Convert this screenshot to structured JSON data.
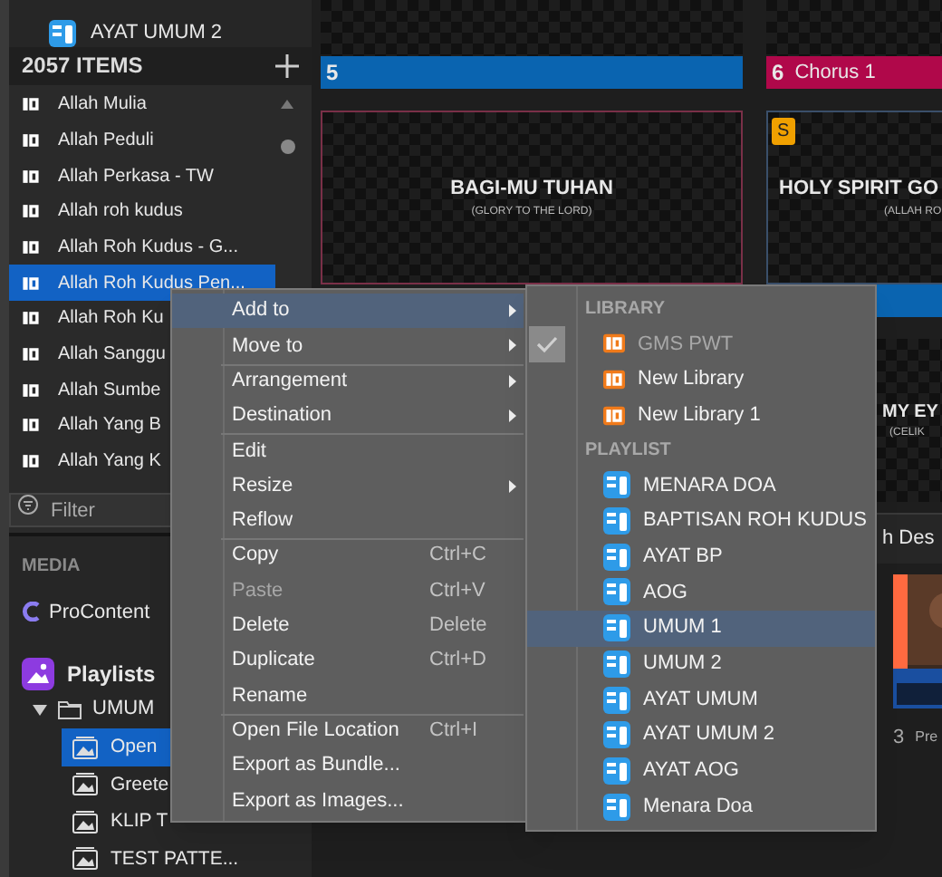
{
  "playlist_rows": [
    {
      "label": "AYAT UMUM 2"
    }
  ],
  "library": {
    "count": "2057 ITEMS",
    "items": [
      {
        "label": "Allah Mulia",
        "selected": false
      },
      {
        "label": "Allah Peduli",
        "selected": false
      },
      {
        "label": "Allah Perkasa - TW",
        "selected": false
      },
      {
        "label": "Allah roh kudus",
        "selected": false
      },
      {
        "label": "Allah Roh Kudus - G...",
        "selected": false
      },
      {
        "label": "Allah Roh Kudus Pen...",
        "selected": true
      },
      {
        "label": "Allah Roh Ku",
        "selected": false
      },
      {
        "label": "Allah Sanggu",
        "selected": false
      },
      {
        "label": "Allah Sumbe",
        "selected": false
      },
      {
        "label": "Allah Yang B",
        "selected": false
      },
      {
        "label": "Allah Yang K",
        "selected": false
      }
    ]
  },
  "filter": {
    "placeholder": "Filter"
  },
  "media": {
    "title": "MEDIA",
    "source": "ProContent",
    "playlists": "Playlists",
    "tree": [
      {
        "label": "UMUM",
        "expanded": true,
        "children": [
          {
            "label": "Open",
            "selected": true
          },
          {
            "label": "Greete",
            "selected": false
          },
          {
            "label": "KLIP T",
            "selected": false
          },
          {
            "label": "TEST PATTE...",
            "selected": false
          }
        ]
      }
    ]
  },
  "slides": {
    "top_row": [
      {
        "number": "5",
        "color": "#0a64b0"
      },
      {
        "number": "6",
        "label": "Chorus 1",
        "color": "#b0084a"
      }
    ],
    "middle_row": [
      {
        "title": "BAGI-MU TUHAN",
        "subtitle": "(GLORY TO THE LORD)"
      },
      {
        "title": "HOLY SPIRIT GO",
        "subtitle": "(ALLAH RO",
        "badge": "S"
      }
    ],
    "lower_row": [
      {
        "title": "MY EY",
        "subtitle": "(CELIK"
      }
    ],
    "section_label": "h Des",
    "media_item": {
      "number": "3",
      "label": "Pre"
    }
  },
  "context_menu": {
    "items": [
      {
        "label": "Add to",
        "submenu": true,
        "disabled": false,
        "selected": true,
        "separator_before": false
      },
      {
        "label": "Move to",
        "submenu": true,
        "disabled": false,
        "selected": false,
        "separator_before": false
      },
      {
        "label": "Arrangement",
        "submenu": true,
        "disabled": false,
        "selected": false,
        "separator_before": true
      },
      {
        "label": "Destination",
        "submenu": true,
        "disabled": false,
        "selected": false,
        "separator_before": false
      },
      {
        "label": "Edit",
        "submenu": false,
        "disabled": false,
        "selected": false,
        "separator_before": true
      },
      {
        "label": "Resize",
        "submenu": true,
        "disabled": false,
        "selected": false,
        "separator_before": false
      },
      {
        "label": "Reflow",
        "submenu": false,
        "disabled": false,
        "selected": false,
        "separator_before": false
      },
      {
        "label": "Copy",
        "shortcut": "Ctrl+C",
        "submenu": false,
        "disabled": false,
        "selected": false,
        "separator_before": true
      },
      {
        "label": "Paste",
        "shortcut": "Ctrl+V",
        "submenu": false,
        "disabled": true,
        "selected": false,
        "separator_before": false
      },
      {
        "label": "Delete",
        "shortcut": "Delete",
        "submenu": false,
        "disabled": false,
        "selected": false,
        "separator_before": false
      },
      {
        "label": "Duplicate",
        "shortcut": "Ctrl+D",
        "submenu": false,
        "disabled": false,
        "selected": false,
        "separator_before": false
      },
      {
        "label": "Rename",
        "submenu": false,
        "disabled": false,
        "selected": false,
        "separator_before": false
      },
      {
        "label": "Open File Location",
        "shortcut": "Ctrl+I",
        "submenu": false,
        "disabled": false,
        "selected": false,
        "separator_before": true
      },
      {
        "label": "Export as Bundle...",
        "submenu": false,
        "disabled": false,
        "selected": false,
        "separator_before": false
      },
      {
        "label": "Export as Images...",
        "submenu": false,
        "disabled": false,
        "selected": false,
        "separator_before": false
      }
    ]
  },
  "submenu": {
    "sections": [
      {
        "title": "LIBRARY",
        "items": [
          {
            "label": "GMS PWT",
            "kind": "library",
            "checked": true,
            "disabled": true,
            "selected": false
          },
          {
            "label": "New Library",
            "kind": "library",
            "checked": false,
            "disabled": false,
            "selected": false
          },
          {
            "label": "New Library 1",
            "kind": "library",
            "checked": false,
            "disabled": false,
            "selected": false
          }
        ]
      },
      {
        "title": "PLAYLIST",
        "items": [
          {
            "label": "MENARA DOA",
            "kind": "playlist",
            "checked": false,
            "disabled": false,
            "selected": false
          },
          {
            "label": "BAPTISAN ROH KUDUS",
            "kind": "playlist",
            "checked": false,
            "disabled": false,
            "selected": false
          },
          {
            "label": "AYAT BP",
            "kind": "playlist",
            "checked": false,
            "disabled": false,
            "selected": false
          },
          {
            "label": "AOG",
            "kind": "playlist",
            "checked": false,
            "disabled": false,
            "selected": false
          },
          {
            "label": "UMUM 1",
            "kind": "playlist",
            "checked": false,
            "disabled": false,
            "selected": true
          },
          {
            "label": "UMUM 2",
            "kind": "playlist",
            "checked": false,
            "disabled": false,
            "selected": false
          },
          {
            "label": "AYAT UMUM",
            "kind": "playlist",
            "checked": false,
            "disabled": false,
            "selected": false
          },
          {
            "label": "AYAT UMUM 2",
            "kind": "playlist",
            "checked": false,
            "disabled": false,
            "selected": false
          },
          {
            "label": "AYAT AOG",
            "kind": "playlist",
            "checked": false,
            "disabled": false,
            "selected": false
          },
          {
            "label": "Menara Doa",
            "kind": "playlist",
            "checked": false,
            "disabled": false,
            "selected": false
          }
        ]
      }
    ]
  }
}
